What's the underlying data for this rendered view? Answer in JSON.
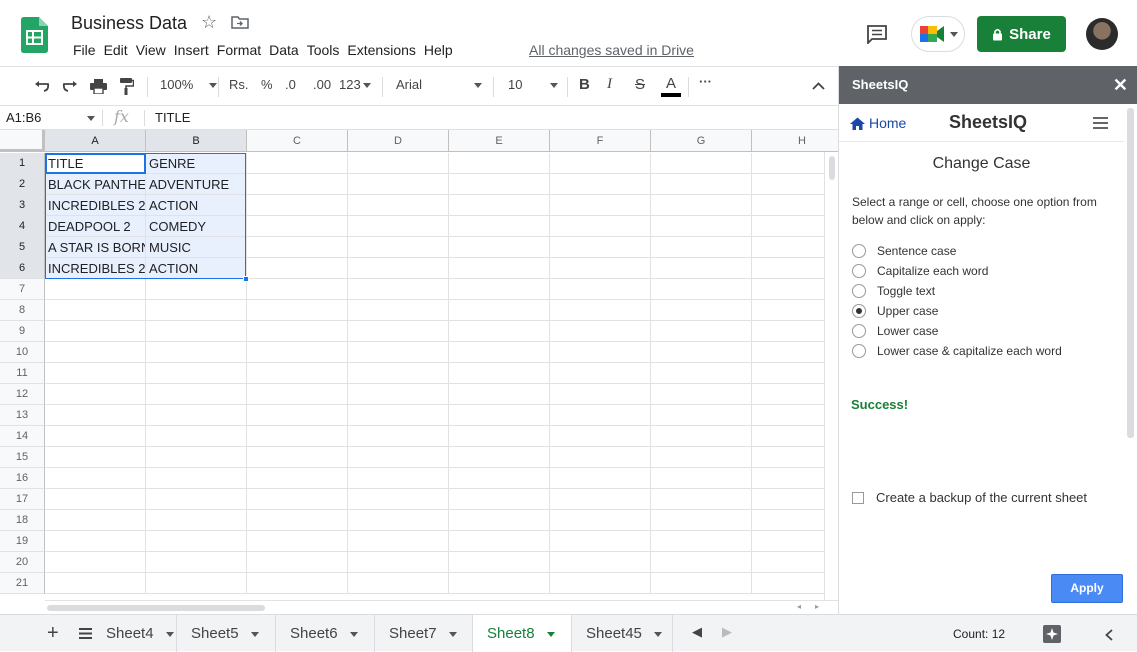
{
  "doc": {
    "title": "Business Data",
    "saved_status": "All changes saved in Drive"
  },
  "menu": [
    "File",
    "Edit",
    "View",
    "Insert",
    "Format",
    "Data",
    "Tools",
    "Extensions",
    "Help"
  ],
  "header": {
    "share_label": "Share"
  },
  "toolbar": {
    "zoom": "100%",
    "currency": "Rs.",
    "percent": "%",
    "dec_less": ".0",
    "dec_more": ".00",
    "format_more": "123",
    "font": "Arial",
    "font_size": "10",
    "bold": "B",
    "italic": "I",
    "strike": "S",
    "text_color": "A",
    "more": "···"
  },
  "formula_bar": {
    "name_box": "A1:B6",
    "fx": "fx",
    "value": "TITLE"
  },
  "columns": [
    "A",
    "B",
    "C",
    "D",
    "E",
    "F",
    "G",
    "H"
  ],
  "rows": [
    "1",
    "2",
    "3",
    "4",
    "5",
    "6",
    "7",
    "8",
    "9",
    "10",
    "11",
    "12",
    "13",
    "14",
    "15",
    "16",
    "17",
    "18",
    "19",
    "20",
    "21"
  ],
  "cells": [
    [
      "TITLE",
      "GENRE"
    ],
    [
      "BLACK PANTHER",
      "ADVENTURE"
    ],
    [
      "INCREDIBLES 2",
      "ACTION"
    ],
    [
      "DEADPOOL 2",
      "COMEDY"
    ],
    [
      "A STAR IS BORN",
      "MUSIC"
    ],
    [
      "INCREDIBLES 2",
      "ACTION"
    ]
  ],
  "sheets": [
    "Sheet4",
    "Sheet5",
    "Sheet6",
    "Sheet7",
    "Sheet8",
    "Sheet45"
  ],
  "active_sheet": "Sheet8",
  "status": {
    "count": "Count: 12"
  },
  "panel": {
    "app_name": "SheetsIQ",
    "home_label": "Home",
    "brand": "SheetsIQ",
    "title": "Change Case",
    "description": "Select a range or cell, choose one option from below and click on apply:",
    "options": [
      "Sentence case",
      "Capitalize each word",
      "Toggle text",
      "Upper case",
      "Lower case",
      "Lower case & capitalize each word"
    ],
    "selected_option": "Upper case",
    "success": "Success!",
    "backup_label": "Create a backup of the current sheet",
    "apply_label": "Apply"
  },
  "colors": {
    "brand_green": "#188038",
    "selection_blue": "#1a73e8",
    "panel_header": "#5f6368",
    "apply_blue": "#4a8af4"
  }
}
